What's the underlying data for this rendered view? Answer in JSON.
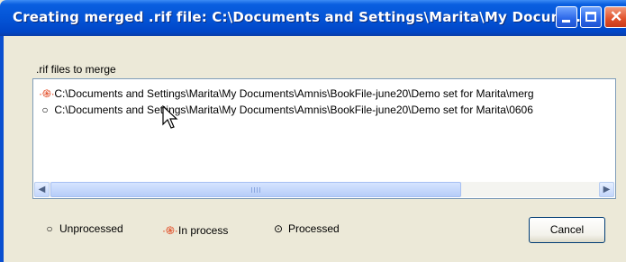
{
  "window": {
    "title": "Creating merged .rif file:  C:\\Documents and Settings\\Marita\\My Docum..."
  },
  "list": {
    "label": ".rif files to merge",
    "items": [
      {
        "status_symbol": "·֍·",
        "status": "in process",
        "path": "C:\\Documents and Settings\\Marita\\My Documents\\Amnis\\BookFile-june20\\Demo set for Marita\\merg"
      },
      {
        "status_symbol": "○",
        "status": "unprocessed",
        "path": "C:\\Documents and Settings\\Marita\\My Documents\\Amnis\\BookFile-june20\\Demo set for Marita\\0606"
      }
    ]
  },
  "legend": {
    "unprocessed": {
      "symbol": "○",
      "label": "Unprocessed"
    },
    "in_process": {
      "symbol": "·֍·",
      "label": "In process"
    },
    "processed": {
      "symbol": "⊙",
      "label": "Processed"
    }
  },
  "buttons": {
    "cancel": "Cancel"
  },
  "colors": {
    "titlebar": "#0454d6",
    "in_process": "#e03a10",
    "dialog_bg": "#ece9d8"
  }
}
